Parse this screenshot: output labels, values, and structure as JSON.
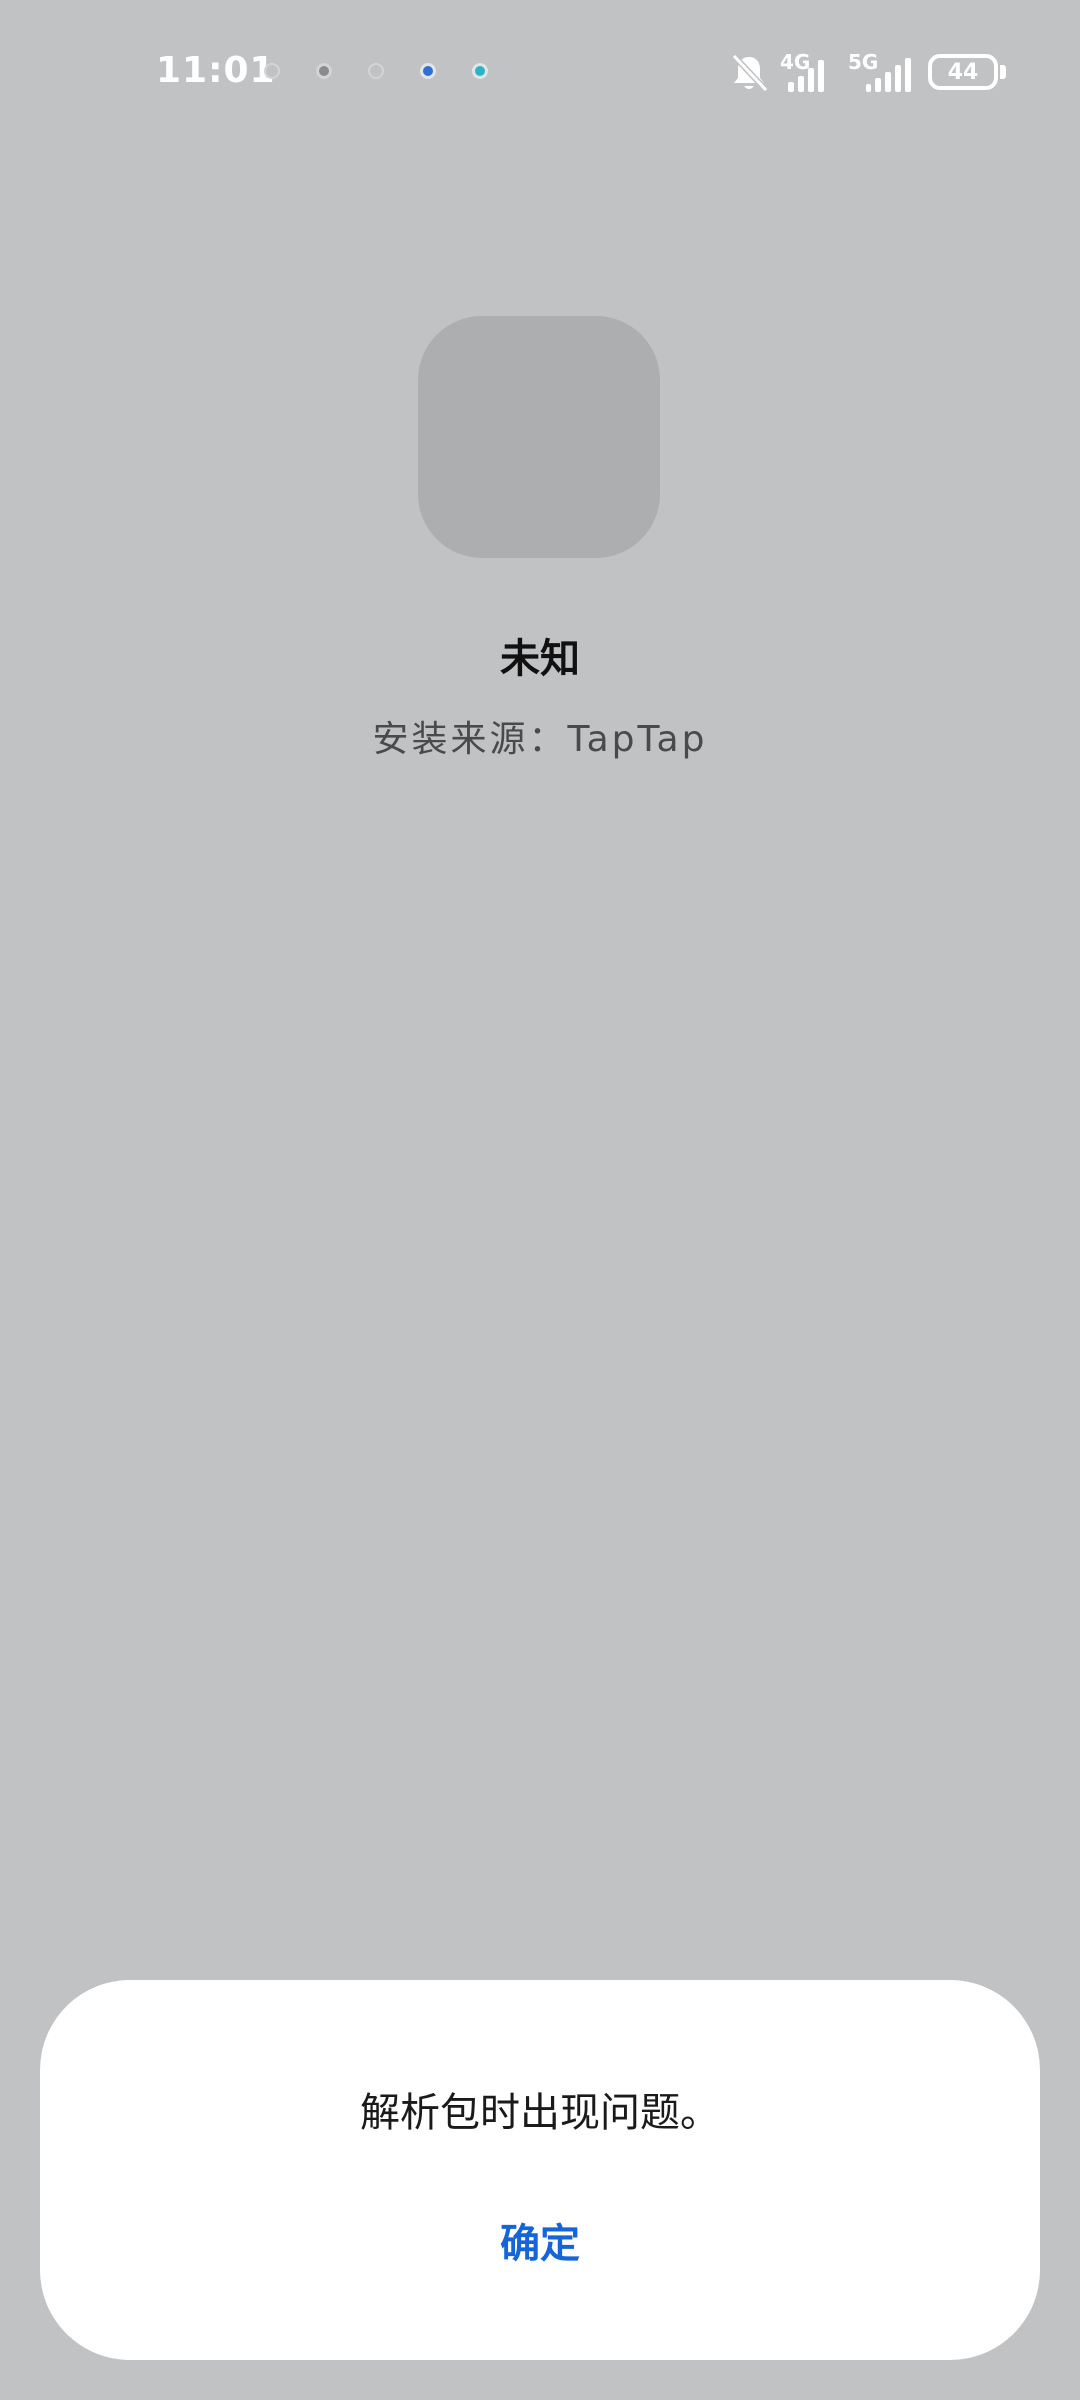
{
  "status_bar": {
    "time": "11:01",
    "network_1": "4G",
    "network_2": "5G",
    "battery_level": "44",
    "notification_icons": [
      "sync-icon",
      "camera-dot-icon",
      "sync-icon",
      "app-dot-blue-icon",
      "app-dot-teal-icon"
    ],
    "notification_colors": [
      "#c9cacc",
      "#8a8b8d",
      "#c9cacc",
      "#2f6fd6",
      "#2bb3c6"
    ]
  },
  "app": {
    "name": "未知",
    "install_source": "安装来源：TapTap"
  },
  "dialog": {
    "message": "解析包时出现问题。",
    "confirm_label": "确定"
  },
  "colors": {
    "background": "#c1c2c4",
    "accent": "#1565d8"
  }
}
